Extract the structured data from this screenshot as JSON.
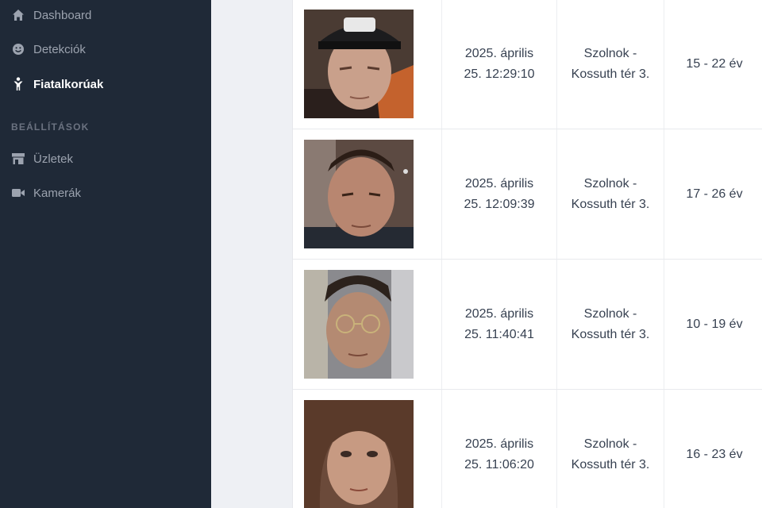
{
  "sidebar": {
    "items": [
      {
        "label": "Dashboard",
        "icon": "home-icon"
      },
      {
        "label": "Detekciók",
        "icon": "smiley-icon"
      },
      {
        "label": "Fiatalkorúak",
        "icon": "child-icon"
      }
    ],
    "section_label": "BEÁLLÍTÁSOK",
    "settings_items": [
      {
        "label": "Üzletek",
        "icon": "store-icon"
      },
      {
        "label": "Kamerák",
        "icon": "video-camera-icon"
      }
    ]
  },
  "rows": [
    {
      "date_line1": "2025. április",
      "date_line2": "25. 12:29:10",
      "loc_line1": "Szolnok -",
      "loc_line2": "Kossuth tér 3.",
      "age": "15 - 22 év"
    },
    {
      "date_line1": "2025. április",
      "date_line2": "25. 12:09:39",
      "loc_line1": "Szolnok -",
      "loc_line2": "Kossuth tér 3.",
      "age": "17 - 26 év"
    },
    {
      "date_line1": "2025. április",
      "date_line2": "25. 11:40:41",
      "loc_line1": "Szolnok -",
      "loc_line2": "Kossuth tér 3.",
      "age": "10 - 19 év"
    },
    {
      "date_line1": "2025. április",
      "date_line2": "25. 11:06:20",
      "loc_line1": "Szolnok -",
      "loc_line2": "Kossuth tér 3.",
      "age": "16 - 23 év"
    }
  ]
}
